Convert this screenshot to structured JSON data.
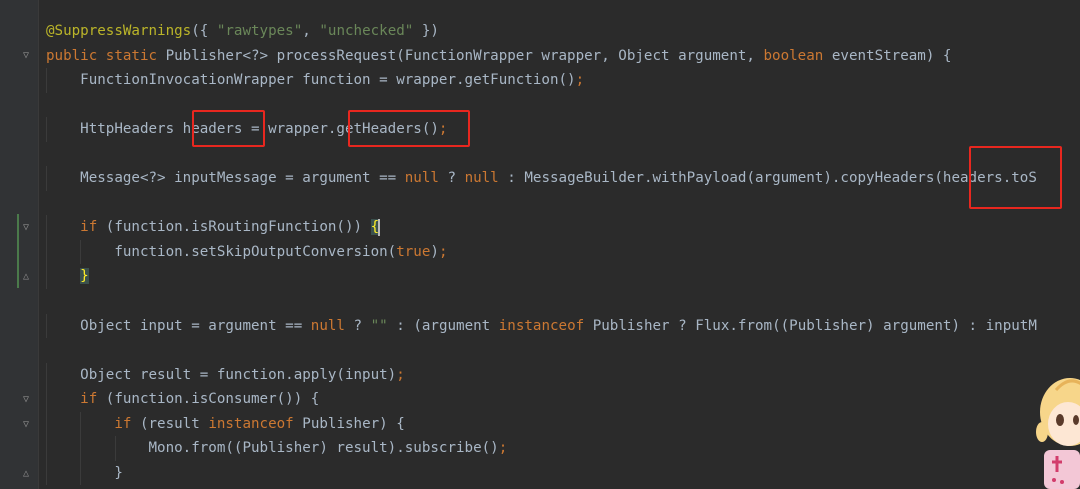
{
  "code_lines": [
    [
      {
        "t": "@SuppressWarnings",
        "c": "ann"
      },
      {
        "t": "({ ",
        "c": "def"
      },
      {
        "t": "\"rawtypes\"",
        "c": "str"
      },
      {
        "t": ", ",
        "c": "def"
      },
      {
        "t": "\"unchecked\"",
        "c": "str"
      },
      {
        "t": " })",
        "c": "def"
      }
    ],
    [
      {
        "t": "public static ",
        "c": "kw"
      },
      {
        "t": "Publisher<?> processRequest(FunctionWrapper wrapper, Object argument, ",
        "c": "def"
      },
      {
        "t": "boolean ",
        "c": "kw"
      },
      {
        "t": "eventStream) {",
        "c": "def"
      }
    ],
    [
      {
        "t": "    FunctionInvocationWrapper function = wrapper.getFunction()",
        "c": "def"
      },
      {
        "t": ";",
        "c": "kw"
      }
    ],
    [],
    [
      {
        "t": "    HttpHeaders headers = wrapper.getHeaders()",
        "c": "def"
      },
      {
        "t": ";",
        "c": "kw"
      }
    ],
    [],
    [
      {
        "t": "    Message<?> inputMessage = argument == ",
        "c": "def"
      },
      {
        "t": "null ",
        "c": "kw"
      },
      {
        "t": "? ",
        "c": "def"
      },
      {
        "t": "null ",
        "c": "kw"
      },
      {
        "t": ": MessageBuilder.withPayload(argument).copyHeaders(headers.toS",
        "c": "def"
      }
    ],
    [],
    [
      {
        "t": "    ",
        "c": "def"
      },
      {
        "t": "if ",
        "c": "kw"
      },
      {
        "t": "(function.isRoutingFunction()) ",
        "c": "def"
      },
      {
        "t": "{",
        "c": "brace-hl"
      }
    ],
    [
      {
        "t": "        function.setSkipOutputConversion(",
        "c": "def"
      },
      {
        "t": "true",
        "c": "kw"
      },
      {
        "t": ")",
        "c": "def"
      },
      {
        "t": ";",
        "c": "kw"
      }
    ],
    [
      {
        "t": "    ",
        "c": "def"
      },
      {
        "t": "}",
        "c": "brace-hl"
      }
    ],
    [],
    [
      {
        "t": "    Object input = argument == ",
        "c": "def"
      },
      {
        "t": "null ",
        "c": "kw"
      },
      {
        "t": "? ",
        "c": "def"
      },
      {
        "t": "\"\"",
        "c": "str"
      },
      {
        "t": " : (argument ",
        "c": "def"
      },
      {
        "t": "instanceof ",
        "c": "kw"
      },
      {
        "t": "Publisher ? Flux.from((Publisher) argument) : inputM",
        "c": "def"
      }
    ],
    [],
    [
      {
        "t": "    Object result = function.apply(input)",
        "c": "def"
      },
      {
        "t": ";",
        "c": "kw"
      }
    ],
    [
      {
        "t": "    ",
        "c": "def"
      },
      {
        "t": "if ",
        "c": "kw"
      },
      {
        "t": "(function.isConsumer()) {",
        "c": "def"
      }
    ],
    [
      {
        "t": "        ",
        "c": "def"
      },
      {
        "t": "if ",
        "c": "kw"
      },
      {
        "t": "(result ",
        "c": "def"
      },
      {
        "t": "instanceof ",
        "c": "kw"
      },
      {
        "t": "Publisher) {",
        "c": "def"
      }
    ],
    [
      {
        "t": "            Mono.from((Publisher) result).subscribe()",
        "c": "def"
      },
      {
        "t": ";",
        "c": "kw"
      }
    ],
    [
      {
        "t": "        }",
        "c": "def"
      }
    ]
  ],
  "colors": {
    "background": "#2b2b2b",
    "keyword": "#cc7832",
    "string": "#6a8759",
    "annotation": "#bbb529",
    "default": "#a9b7c6",
    "highlight_box": "#e8271f"
  }
}
